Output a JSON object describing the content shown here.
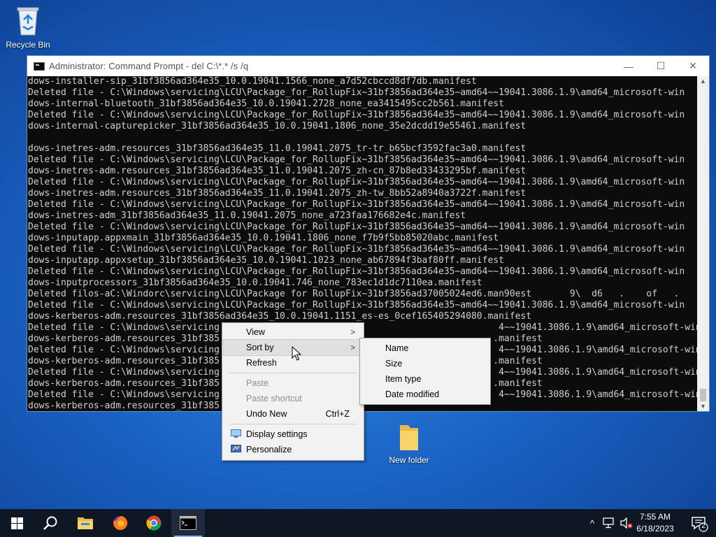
{
  "desktop": {
    "recycle_bin_label": "Recycle Bin",
    "new_folder_label": "New folder"
  },
  "cmd": {
    "title": "Administrator:  Command Prompt - del  C:\\*.* /s /q",
    "minimize_glyph": "—",
    "maximize_glyph": "☐",
    "close_glyph": "✕",
    "lines": [
      "dows-installer-sip_31bf3856ad364e35_10.0.19041.1566_none_a7d52cbccd8df7db.manifest",
      "Deleted file - C:\\Windows\\servicing\\LCU\\Package_for_RollupFix~31bf3856ad364e35~amd64~~19041.3086.1.9\\amd64_microsoft-win",
      "dows-internal-bluetooth_31bf3856ad364e35_10.0.19041.2728_none_ea3415495cc2b561.manifest",
      "Deleted file - C:\\Windows\\servicing\\LCU\\Package_for_RollupFix~31bf3856ad364e35~amd64~~19041.3086.1.9\\amd64_microsoft-win",
      "dows-internal-capturepicker_31bf3856ad364e35_10.0.19041.1806_none_35e2dcdd19e55461.manifest",
      "",
      "dows-inetres-adm.resources_31bf3856ad364e35_11.0.19041.2075_tr-tr_b65bcf3592fac3a0.manifest",
      "Deleted file - C:\\Windows\\servicing\\LCU\\Package_for_RollupFix~31bf3856ad364e35~amd64~~19041.3086.1.9\\amd64_microsoft-win",
      "dows-inetres-adm.resources_31bf3856ad364e35_11.0.19041.2075_zh-cn_87b8ed33433295bf.manifest",
      "Deleted file - C:\\Windows\\servicing\\LCU\\Package_for_RollupFix~31bf3856ad364e35~amd64~~19041.3086.1.9\\amd64_microsoft-win",
      "dows-inetres-adm.resources_31bf3856ad364e35_11.0.19041.2075_zh-tw_8bb52a8940a3722f.manifest",
      "Deleted file - C:\\Windows\\servicing\\LCU\\Package_for_RollupFix~31bf3856ad364e35~amd64~~19041.3086.1.9\\amd64_microsoft-win",
      "dows-inetres-adm_31bf3856ad364e35_11.0.19041.2075_none_a723faa176682e4c.manifest",
      "Deleted file - C:\\Windows\\servicing\\LCU\\Package_for_RollupFix~31bf3856ad364e35~amd64~~19041.3086.1.9\\amd64_microsoft-win",
      "dows-inputapp.appxmain_31bf3856ad364e35_10.0.19041.1806_none_f7b9f5bb85020abc.manifest",
      "Deleted file - C:\\Windows\\servicing\\LCU\\Package_for_RollupFix~31bf3856ad364e35~amd64~~19041.3086.1.9\\amd64_microsoft-win",
      "dows-inputapp.appxsetup_31bf3856ad364e35_10.0.19041.1023_none_ab67894f3baf80ff.manifest",
      "Deleted file - C:\\Windows\\servicing\\LCU\\Package_for_RollupFix~31bf3856ad364e35~amd64~~19041.3086.1.9\\amd64_microsoft-win",
      "dows-inputprocessors_31bf3856ad364e35_10.0.19041.746_none_783ec1d1dc7110ea.manifest",
      "Deleted filos-aC:\\Windorc\\servicing\\LCU\\Package for RollupFix~31bf3856ad37005024ed6.man90est       9\\  d6   .    of   .",
      "Deleted file - C:\\Windows\\servicing\\LCU\\Package_for_RollupFix~31bf3856ad364e35~amd64~~19041.3086.1.9\\amd64_microsoft-win",
      "dows-kerberos-adm.resources_31bf3856ad364e35_10.0.19041.1151_es-es_0cef165405294080.manifest",
      "Deleted file - C:\\Windows\\servicing                                                   4~~19041.3086.1.9\\amd64_microsoft-win",
      "dows-kerberos-adm.resources_31bf385                                                  .manifest",
      "Deleted file - C:\\Windows\\servicing                                                   4~~19041.3086.1.9\\amd64_microsoft-win",
      "dows-kerberos-adm.resources_31bf385                                                  .manifest",
      "Deleted file - C:\\Windows\\servicing                                                   4~~19041.3086.1.9\\amd64_microsoft-win",
      "dows-kerberos-adm.resources_31bf385                                                  .manifest",
      "Deleted file - C:\\Windows\\servicing                                                   4~~19041.3086.1.9\\amd64_microsoft-win",
      "dows-kerberos-adm.resources_31bf385"
    ]
  },
  "context_menu": {
    "view": "View",
    "sort_by": "Sort by",
    "refresh": "Refresh",
    "paste": "Paste",
    "paste_shortcut": "Paste shortcut",
    "undo_new": "Undo New",
    "undo_new_shortcut": "Ctrl+Z",
    "display_settings": "Display settings",
    "personalize": "Personalize",
    "arrow_glyph": ">"
  },
  "sort_submenu": {
    "name": "Name",
    "size": "Size",
    "item_type": "Item type",
    "date_modified": "Date modified"
  },
  "taskbar": {
    "time": "7:55 AM",
    "date": "6/18/2023",
    "notification_count": "2",
    "chevron_glyph": "^"
  },
  "colors": {
    "accent": "#1a63c4",
    "taskbar": "#0f1624"
  }
}
